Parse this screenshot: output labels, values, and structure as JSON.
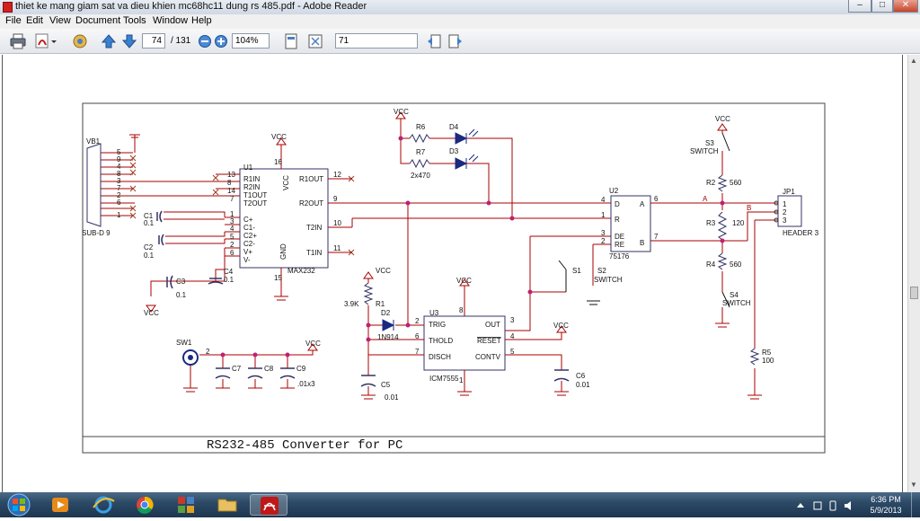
{
  "window": {
    "title": "thiet ke mang giam sat va dieu khien mc68hc11 dung rs 485.pdf - Adobe Reader",
    "minimize": "–",
    "maximize": "□",
    "close": "✕"
  },
  "menu": [
    "File",
    "Edit",
    "View",
    "Document",
    "Tools",
    "Window",
    "Help"
  ],
  "toolbar": {
    "page_current": "74",
    "page_total": "/ 131",
    "zoom": "104%",
    "find_value": "71"
  },
  "schematic": {
    "title": "RS232-485 Converter for PC",
    "vb1": {
      "ref": "VB1",
      "part": "SUB-D 9",
      "pins": [
        "5",
        "9",
        "4",
        "8",
        "3",
        "7",
        "2",
        "6",
        "1"
      ]
    },
    "u1": {
      "ref": "U1",
      "part": "MAX232",
      "left_pins": [
        {
          "num": "13",
          "name": "R1IN"
        },
        {
          "num": "8",
          "name": "R2IN"
        },
        {
          "num": "14",
          "name": "T1OUT"
        },
        {
          "num": "7",
          "name": "T2OUT"
        },
        {
          "num": "1",
          "name": "C+"
        },
        {
          "num": "3",
          "name": "C1-"
        },
        {
          "num": "4",
          "name": "C2+"
        },
        {
          "num": "5",
          "name": "C2-"
        },
        {
          "num": "2",
          "name": "V+"
        },
        {
          "num": "6",
          "name": "V-"
        }
      ],
      "right_pins": [
        {
          "num": "12",
          "name": "R1OUT"
        },
        {
          "num": "9",
          "name": "R2OUT"
        },
        {
          "num": "10",
          "name": "T2IN"
        },
        {
          "num": "11",
          "name": "T1IN"
        }
      ],
      "vcc_pin": "16",
      "gnd_pin": "15",
      "vcc_label": "VCC",
      "gnd_label": "GND"
    },
    "caps_left": [
      {
        "ref": "C1",
        "value": "0.1"
      },
      {
        "ref": "C2",
        "value": "0.1"
      },
      {
        "ref": "C3",
        "value": "0.1"
      },
      {
        "ref": "C4",
        "value": "0.1"
      }
    ],
    "vcc": "VCC",
    "r6": "R6",
    "r7": "R7",
    "r67_value": "2x470",
    "d4": "D4",
    "d3": "D3",
    "u2": {
      "ref": "U2",
      "part": "75176",
      "pins": [
        {
          "num": "4",
          "name": "D"
        },
        {
          "num": "1",
          "name": "R"
        },
        {
          "num": "3",
          "name": "DE"
        },
        {
          "num": "2",
          "name": "RE"
        },
        {
          "num": "6",
          "name": "A"
        },
        {
          "num": "7",
          "name": "B"
        }
      ]
    },
    "net_a": "A",
    "net_b": "B",
    "r2": {
      "ref": "R2",
      "value": "560"
    },
    "r3": {
      "ref": "R3",
      "value": "120"
    },
    "r4": {
      "ref": "R4",
      "value": "560"
    },
    "r5": {
      "ref": "R5",
      "value": "100"
    },
    "s3": {
      "ref": "S3",
      "label": "SWITCH"
    },
    "s4": {
      "ref": "S4",
      "label": "SWITCH"
    },
    "s1": "S1",
    "s2": {
      "ref": "S2",
      "label": "SWITCH"
    },
    "jp1": {
      "ref": "JP1",
      "part": "HEADER 3",
      "pins": [
        "1",
        "2",
        "3"
      ]
    },
    "r1": {
      "ref": "R1",
      "value": "3.9K"
    },
    "d2": {
      "ref": "D2",
      "part": "1N914"
    },
    "u3": {
      "ref": "U3",
      "part": "ICM7555",
      "left": [
        {
          "num": "2",
          "name": "TRIG"
        },
        {
          "num": "6",
          "name": "THOLD"
        },
        {
          "num": "7",
          "name": "DISCH"
        }
      ],
      "right": [
        {
          "num": "3",
          "name": "OUT"
        },
        {
          "num": "4",
          "name": "RESET"
        },
        {
          "num": "5",
          "name": "CONTV"
        }
      ],
      "vcc_pin": "8",
      "gnd_pin": "1",
      "vcc_label": "VCC",
      "gnd_label": "GND"
    },
    "c5": {
      "ref": "C5",
      "value": "0.01"
    },
    "c6": {
      "ref": "C6",
      "value": "0.01"
    },
    "sw1": {
      "ref": "SW1",
      "pin": "2"
    },
    "c7": "C7",
    "c8": "C8",
    "c9": "C9",
    "c789_value": ".01x3"
  },
  "taskbar": {
    "clock_time": "6:36 PM",
    "clock_date": "5/9/2013"
  }
}
